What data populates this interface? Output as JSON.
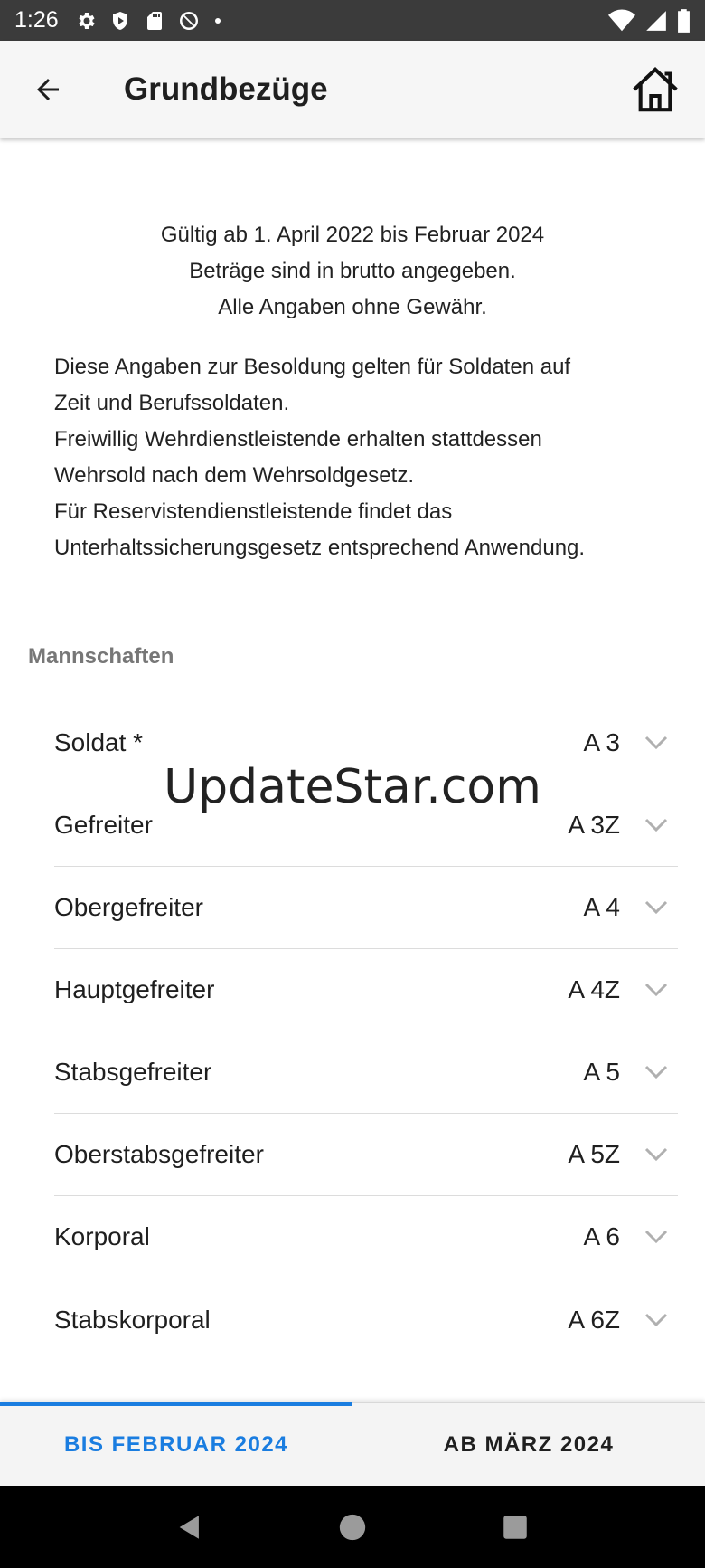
{
  "status_bar": {
    "time": "1:26",
    "left_icons": [
      "gear-icon",
      "shield-play-icon",
      "sd-card-icon",
      "no-tracking-icon",
      "dot-icon"
    ],
    "right_icons": [
      "wifi-icon",
      "signal-icon",
      "battery-icon"
    ]
  },
  "app_bar": {
    "title": "Grundbezüge",
    "back_icon": "arrow-left-icon",
    "home_icon": "home-icon"
  },
  "intro": {
    "centered_lines": [
      "Gültig ab 1. April 2022 bis Februar 2024",
      "Beträge sind in brutto angegeben.",
      "Alle Angaben ohne Gewähr."
    ],
    "paragraph_lines": [
      "Diese Angaben zur Besoldung gelten für Soldaten auf",
      "Zeit und Berufssoldaten.",
      "Freiwillig Wehrdienstleistende erhalten stattdessen",
      "Wehrsold nach dem Wehrsoldgesetz.",
      "Für Reservistendienstleistende findet das",
      "Unterhaltssicherungsgesetz entsprechend Anwendung."
    ]
  },
  "section": {
    "title": "Mannschaften",
    "grades": [
      {
        "name": "Soldat *",
        "code": "A 3"
      },
      {
        "name": "Gefreiter",
        "code": "A 3Z"
      },
      {
        "name": "Obergefreiter",
        "code": "A 4"
      },
      {
        "name": "Hauptgefreiter",
        "code": "A 4Z"
      },
      {
        "name": "Stabsgefreiter",
        "code": "A 5"
      },
      {
        "name": "Oberstabsgefreiter",
        "code": "A 5Z"
      },
      {
        "name": "Korporal",
        "code": "A 6"
      },
      {
        "name": "Stabskorporal",
        "code": "A 6Z"
      }
    ]
  },
  "watermark": "UpdateStar.com",
  "tabs": [
    {
      "label": "BIS FEBRUAR 2024",
      "active": true
    },
    {
      "label": "AB MÄRZ 2024",
      "active": false
    }
  ],
  "colors": {
    "accent": "#1a7de0",
    "status_bar": "#3b3b3b",
    "app_bar": "#f6f6f6",
    "nav_bar": "#000000"
  }
}
